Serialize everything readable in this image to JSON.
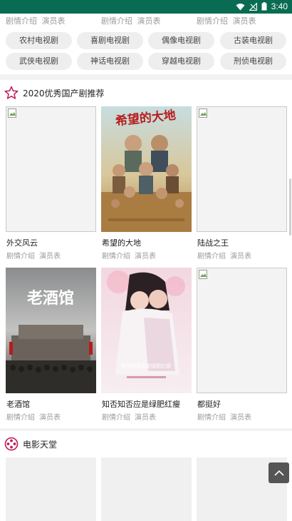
{
  "status_bar": {
    "time": "3:40"
  },
  "top_links": [
    {
      "intro": "剧情介绍",
      "cast": "演员表"
    },
    {
      "intro": "剧情介绍",
      "cast": "演员表"
    },
    {
      "intro": "剧情介绍",
      "cast": "演员表"
    }
  ],
  "categories": [
    "农村电视剧",
    "喜剧电视剧",
    "偶像电视剧",
    "古装电视剧",
    "武侠电视剧",
    "神话电视剧",
    "穿越电视剧",
    "刑侦电视剧"
  ],
  "recommend": {
    "title": "2020优秀国产剧推荐",
    "items": [
      {
        "title": "外交风云",
        "intro": "剧情介绍",
        "cast": "演员表"
      },
      {
        "title": "希望的大地",
        "intro": "剧情介绍",
        "cast": "演员表"
      },
      {
        "title": "陆战之王",
        "intro": "剧情介绍",
        "cast": "演员表"
      },
      {
        "title": "老酒馆",
        "intro": "剧情介绍",
        "cast": "演员表"
      },
      {
        "title": "知否知否应是绿肥红瘦",
        "intro": "剧情介绍",
        "cast": "演员表"
      },
      {
        "title": "都挺好",
        "intro": "剧情介绍",
        "cast": "演员表"
      }
    ]
  },
  "poster_text": {
    "p2_title": "希望的大地",
    "p4_title": "老酒馆",
    "p5_title": "知否知否应是绿肥红瘦"
  },
  "movies": {
    "title": "电影天堂"
  },
  "colors": {
    "status_bar": "#0a6b53",
    "section_icon": "#c2185b"
  }
}
